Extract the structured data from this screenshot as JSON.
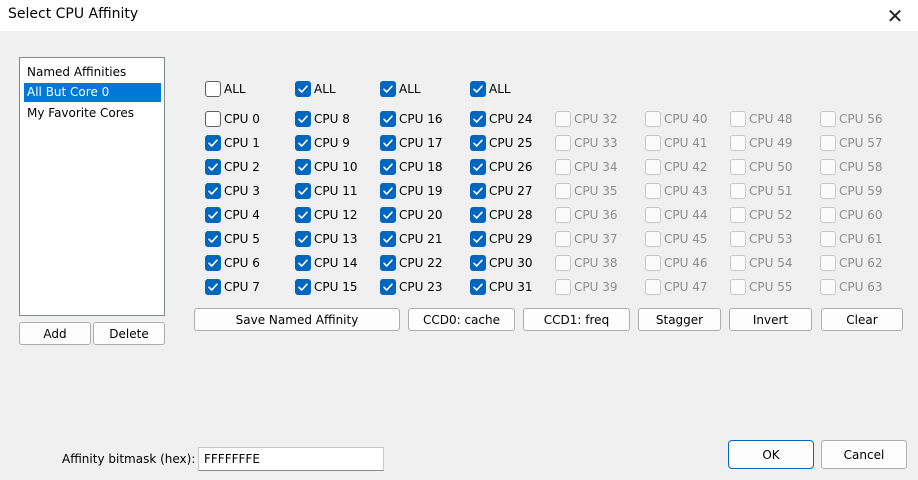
{
  "window": {
    "title": "Select CPU Affinity",
    "close_glyph": "✕"
  },
  "named_list": {
    "items": [
      {
        "label": "Named Affinities",
        "selected": false
      },
      {
        "label": "All But Core 0",
        "selected": true
      },
      {
        "label": "My Favorite Cores",
        "selected": false
      }
    ],
    "add_label": "Add",
    "delete_label": "Delete"
  },
  "columns": [
    {
      "all_label": "ALL",
      "has_all": true,
      "all_checked": false,
      "cpus": [
        {
          "label": "CPU 0",
          "checked": false,
          "enabled": true
        },
        {
          "label": "CPU 1",
          "checked": true,
          "enabled": true
        },
        {
          "label": "CPU 2",
          "checked": true,
          "enabled": true
        },
        {
          "label": "CPU 3",
          "checked": true,
          "enabled": true
        },
        {
          "label": "CPU 4",
          "checked": true,
          "enabled": true
        },
        {
          "label": "CPU 5",
          "checked": true,
          "enabled": true
        },
        {
          "label": "CPU 6",
          "checked": true,
          "enabled": true
        },
        {
          "label": "CPU 7",
          "checked": true,
          "enabled": true
        }
      ]
    },
    {
      "all_label": "ALL",
      "has_all": true,
      "all_checked": true,
      "cpus": [
        {
          "label": "CPU 8",
          "checked": true,
          "enabled": true
        },
        {
          "label": "CPU 9",
          "checked": true,
          "enabled": true
        },
        {
          "label": "CPU 10",
          "checked": true,
          "enabled": true
        },
        {
          "label": "CPU 11",
          "checked": true,
          "enabled": true
        },
        {
          "label": "CPU 12",
          "checked": true,
          "enabled": true
        },
        {
          "label": "CPU 13",
          "checked": true,
          "enabled": true
        },
        {
          "label": "CPU 14",
          "checked": true,
          "enabled": true
        },
        {
          "label": "CPU 15",
          "checked": true,
          "enabled": true
        }
      ]
    },
    {
      "all_label": "ALL",
      "has_all": true,
      "all_checked": true,
      "cpus": [
        {
          "label": "CPU 16",
          "checked": true,
          "enabled": true
        },
        {
          "label": "CPU 17",
          "checked": true,
          "enabled": true
        },
        {
          "label": "CPU 18",
          "checked": true,
          "enabled": true
        },
        {
          "label": "CPU 19",
          "checked": true,
          "enabled": true
        },
        {
          "label": "CPU 20",
          "checked": true,
          "enabled": true
        },
        {
          "label": "CPU 21",
          "checked": true,
          "enabled": true
        },
        {
          "label": "CPU 22",
          "checked": true,
          "enabled": true
        },
        {
          "label": "CPU 23",
          "checked": true,
          "enabled": true
        }
      ]
    },
    {
      "all_label": "ALL",
      "has_all": true,
      "all_checked": true,
      "cpus": [
        {
          "label": "CPU 24",
          "checked": true,
          "enabled": true
        },
        {
          "label": "CPU 25",
          "checked": true,
          "enabled": true
        },
        {
          "label": "CPU 26",
          "checked": true,
          "enabled": true
        },
        {
          "label": "CPU 27",
          "checked": true,
          "enabled": true
        },
        {
          "label": "CPU 28",
          "checked": true,
          "enabled": true
        },
        {
          "label": "CPU 29",
          "checked": true,
          "enabled": true
        },
        {
          "label": "CPU 30",
          "checked": true,
          "enabled": true
        },
        {
          "label": "CPU 31",
          "checked": true,
          "enabled": true
        }
      ]
    },
    {
      "has_all": false,
      "cpus": [
        {
          "label": "CPU 32",
          "checked": false,
          "enabled": false
        },
        {
          "label": "CPU 33",
          "checked": false,
          "enabled": false
        },
        {
          "label": "CPU 34",
          "checked": false,
          "enabled": false
        },
        {
          "label": "CPU 35",
          "checked": false,
          "enabled": false
        },
        {
          "label": "CPU 36",
          "checked": false,
          "enabled": false
        },
        {
          "label": "CPU 37",
          "checked": false,
          "enabled": false
        },
        {
          "label": "CPU 38",
          "checked": false,
          "enabled": false
        },
        {
          "label": "CPU 39",
          "checked": false,
          "enabled": false
        }
      ]
    },
    {
      "has_all": false,
      "cpus": [
        {
          "label": "CPU 40",
          "checked": false,
          "enabled": false
        },
        {
          "label": "CPU 41",
          "checked": false,
          "enabled": false
        },
        {
          "label": "CPU 42",
          "checked": false,
          "enabled": false
        },
        {
          "label": "CPU 43",
          "checked": false,
          "enabled": false
        },
        {
          "label": "CPU 44",
          "checked": false,
          "enabled": false
        },
        {
          "label": "CPU 45",
          "checked": false,
          "enabled": false
        },
        {
          "label": "CPU 46",
          "checked": false,
          "enabled": false
        },
        {
          "label": "CPU 47",
          "checked": false,
          "enabled": false
        }
      ]
    },
    {
      "has_all": false,
      "cpus": [
        {
          "label": "CPU 48",
          "checked": false,
          "enabled": false
        },
        {
          "label": "CPU 49",
          "checked": false,
          "enabled": false
        },
        {
          "label": "CPU 50",
          "checked": false,
          "enabled": false
        },
        {
          "label": "CPU 51",
          "checked": false,
          "enabled": false
        },
        {
          "label": "CPU 52",
          "checked": false,
          "enabled": false
        },
        {
          "label": "CPU 53",
          "checked": false,
          "enabled": false
        },
        {
          "label": "CPU 54",
          "checked": false,
          "enabled": false
        },
        {
          "label": "CPU 55",
          "checked": false,
          "enabled": false
        }
      ]
    },
    {
      "has_all": false,
      "cpus": [
        {
          "label": "CPU 56",
          "checked": false,
          "enabled": false
        },
        {
          "label": "CPU 57",
          "checked": false,
          "enabled": false
        },
        {
          "label": "CPU 58",
          "checked": false,
          "enabled": false
        },
        {
          "label": "CPU 59",
          "checked": false,
          "enabled": false
        },
        {
          "label": "CPU 60",
          "checked": false,
          "enabled": false
        },
        {
          "label": "CPU 61",
          "checked": false,
          "enabled": false
        },
        {
          "label": "CPU 62",
          "checked": false,
          "enabled": false
        },
        {
          "label": "CPU 63",
          "checked": false,
          "enabled": false
        }
      ]
    }
  ],
  "actions": {
    "save_named": "Save Named Affinity",
    "ccd0": "CCD0: cache",
    "ccd1": "CCD1: freq",
    "stagger": "Stagger",
    "invert": "Invert",
    "clear": "Clear"
  },
  "bitmask": {
    "label": "Affinity bitmask (hex):",
    "value": "FFFFFFFE"
  },
  "dialog": {
    "ok": "OK",
    "cancel": "Cancel"
  },
  "colors": {
    "accent": "#0067c0",
    "selection": "#0078d7",
    "background": "#f0f0f0"
  },
  "icons": {
    "close": "close-icon",
    "check": "checkmark-icon"
  }
}
